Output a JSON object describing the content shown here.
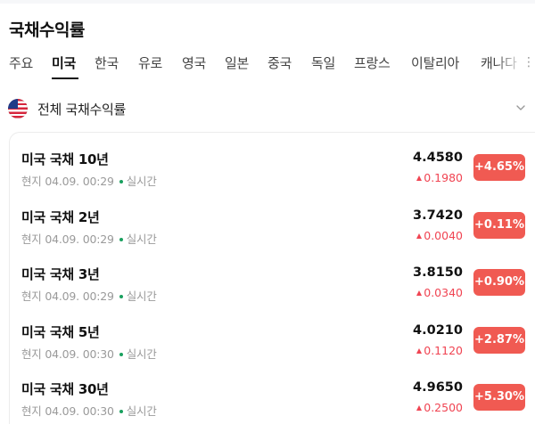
{
  "page": {
    "title": "국채수익률"
  },
  "tabs": [
    {
      "label": "주요",
      "active": false
    },
    {
      "label": "미국",
      "active": true
    },
    {
      "label": "한국",
      "active": false
    },
    {
      "label": "유로",
      "active": false
    },
    {
      "label": "영국",
      "active": false
    },
    {
      "label": "일본",
      "active": false
    },
    {
      "label": "중국",
      "active": false
    },
    {
      "label": "독일",
      "active": false
    },
    {
      "label": "프랑스",
      "active": false
    },
    {
      "label": "이탈리아",
      "active": false
    },
    {
      "label": "캐나다",
      "active": false
    }
  ],
  "filter": {
    "flag_icon": "us-flag-icon",
    "label": "전체 국채수익률",
    "chevron_icon": "chevron-down-icon"
  },
  "bonds": [
    {
      "name": "미국 국채 10년",
      "time": "현지 04.09. 00:29",
      "status": "실시간",
      "value": "4.4580",
      "change": "0.1980",
      "percent": "+4.65%"
    },
    {
      "name": "미국 국채 2년",
      "time": "현지 04.09. 00:29",
      "status": "실시간",
      "value": "3.7420",
      "change": "0.0040",
      "percent": "+0.11%"
    },
    {
      "name": "미국 국채 3년",
      "time": "현지 04.09. 00:29",
      "status": "실시간",
      "value": "3.8150",
      "change": "0.0340",
      "percent": "+0.90%"
    },
    {
      "name": "미국 국채 5년",
      "time": "현지 04.09. 00:30",
      "status": "실시간",
      "value": "4.0210",
      "change": "0.1120",
      "percent": "+2.87%"
    },
    {
      "name": "미국 국채 30년",
      "time": "현지 04.09. 00:30",
      "status": "실시간",
      "value": "4.9650",
      "change": "0.2500",
      "percent": "+5.30%"
    }
  ],
  "colors": {
    "up": "#f04452",
    "badge_up": "#f05a52",
    "live": "#19a05e",
    "text": "#111111",
    "muted": "#9a9a9a"
  }
}
